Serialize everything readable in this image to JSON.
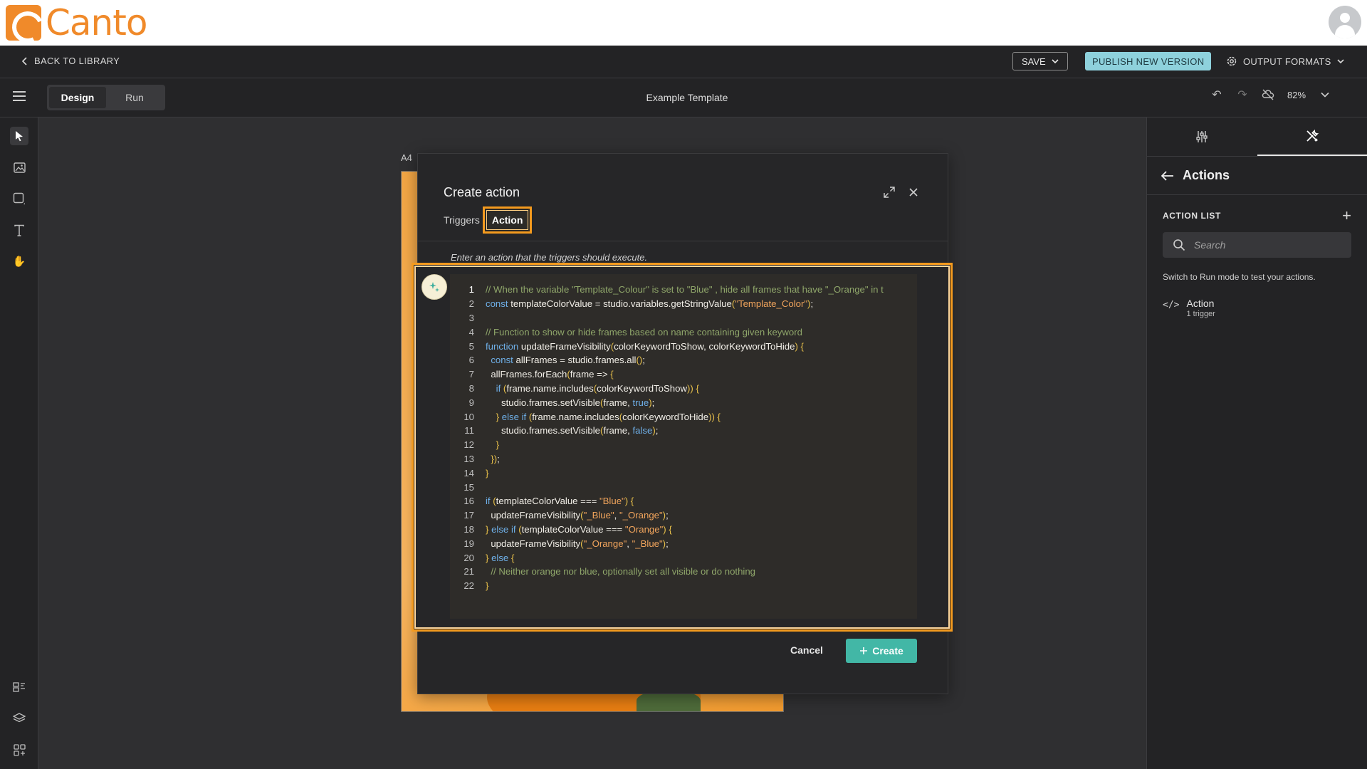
{
  "brand": {
    "name": "Canto",
    "color": "#f08a2a"
  },
  "navbar": {
    "back_label": "BACK TO LIBRARY",
    "save_label": "SAVE",
    "publish_label": "PUBLISH NEW VERSION",
    "output_formats_label": "OUTPUT FORMATS"
  },
  "toolbar": {
    "modes": [
      {
        "label": "Design",
        "active": true
      },
      {
        "label": "Run",
        "active": false
      }
    ],
    "document_title": "Example Template",
    "zoom": "82%"
  },
  "canvas": {
    "page_size_label": "A4"
  },
  "right_panel": {
    "title": "Actions",
    "section_label": "ACTION LIST",
    "search_placeholder": "Search",
    "note": "Switch to Run mode to test your actions.",
    "actions": [
      {
        "name": "Action",
        "subtitle": "1 trigger"
      }
    ]
  },
  "modal": {
    "title": "Create action",
    "tabs": [
      {
        "label": "Triggers",
        "active": false
      },
      {
        "label": "Action",
        "active": true
      }
    ],
    "hint": "Enter an action that the triggers should execute.",
    "cancel_label": "Cancel",
    "create_label": "Create",
    "accent_color": "#f39a1e",
    "create_color": "#42b7a6",
    "code_lines": [
      "// When the variable \"Template_Colour\" is set to \"Blue\" , hide all frames that have \"_Orange\" in t",
      "const templateColorValue = studio.variables.getStringValue(\"Template_Color\");",
      "",
      "// Function to show or hide frames based on name containing given keyword",
      "function updateFrameVisibility(colorKeywordToShow, colorKeywordToHide) {",
      "  const allFrames = studio.frames.all();",
      "  allFrames.forEach(frame => {",
      "    if (frame.name.includes(colorKeywordToShow)) {",
      "      studio.frames.setVisible(frame, true);",
      "    } else if (frame.name.includes(colorKeywordToHide)) {",
      "      studio.frames.setVisible(frame, false);",
      "    }",
      "  });",
      "}",
      "",
      "if (templateColorValue === \"Blue\") {",
      "  updateFrameVisibility(\"_Blue\", \"_Orange\");",
      "} else if (templateColorValue === \"Orange\") {",
      "  updateFrameVisibility(\"_Orange\", \"_Blue\");",
      "} else {",
      "  // Neither orange nor blue, optionally set all visible or do nothing",
      "}"
    ]
  },
  "icons": {
    "left_rail": [
      "select-icon",
      "image-icon",
      "shape-icon",
      "text-icon",
      "hand-icon",
      "components-icon",
      "layers-icon",
      "variables-icon"
    ],
    "right_tabs": [
      "sliders-icon",
      "tools-icon"
    ]
  }
}
